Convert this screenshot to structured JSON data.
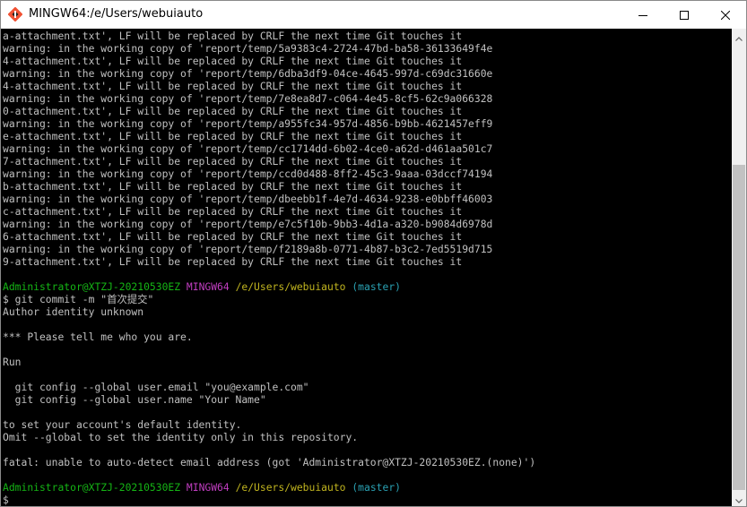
{
  "window": {
    "title": "MINGW64:/e/Users/webuiauto"
  },
  "terminal": {
    "lines": [
      {
        "segments": [
          {
            "text": "a-attachment.txt', LF will be replaced by CRLF the next time Git touches it",
            "color": "white"
          }
        ]
      },
      {
        "segments": [
          {
            "text": "warning: in the working copy of 'report/temp/5a9383c4-2724-47bd-ba58-36133649f4e",
            "color": "white"
          }
        ]
      },
      {
        "segments": [
          {
            "text": "4-attachment.txt', LF will be replaced by CRLF the next time Git touches it",
            "color": "white"
          }
        ]
      },
      {
        "segments": [
          {
            "text": "warning: in the working copy of 'report/temp/6dba3df9-04ce-4645-997d-c69dc31660e",
            "color": "white"
          }
        ]
      },
      {
        "segments": [
          {
            "text": "4-attachment.txt', LF will be replaced by CRLF the next time Git touches it",
            "color": "white"
          }
        ]
      },
      {
        "segments": [
          {
            "text": "warning: in the working copy of 'report/temp/7e8ea8d7-c064-4e45-8cf5-62c9a066328",
            "color": "white"
          }
        ]
      },
      {
        "segments": [
          {
            "text": "0-attachment.txt', LF will be replaced by CRLF the next time Git touches it",
            "color": "white"
          }
        ]
      },
      {
        "segments": [
          {
            "text": "warning: in the working copy of 'report/temp/a955fc34-957d-4856-b9bb-4621457eff9",
            "color": "white"
          }
        ]
      },
      {
        "segments": [
          {
            "text": "e-attachment.txt', LF will be replaced by CRLF the next time Git touches it",
            "color": "white"
          }
        ]
      },
      {
        "segments": [
          {
            "text": "warning: in the working copy of 'report/temp/cc1714dd-6b02-4ce0-a62d-d461aa501c7",
            "color": "white"
          }
        ]
      },
      {
        "segments": [
          {
            "text": "7-attachment.txt', LF will be replaced by CRLF the next time Git touches it",
            "color": "white"
          }
        ]
      },
      {
        "segments": [
          {
            "text": "warning: in the working copy of 'report/temp/ccd0d488-8ff2-45c3-9aaa-03dccf74194",
            "color": "white"
          }
        ]
      },
      {
        "segments": [
          {
            "text": "b-attachment.txt', LF will be replaced by CRLF the next time Git touches it",
            "color": "white"
          }
        ]
      },
      {
        "segments": [
          {
            "text": "warning: in the working copy of 'report/temp/dbeebb1f-4e7d-4634-9238-e0bbff46003",
            "color": "white"
          }
        ]
      },
      {
        "segments": [
          {
            "text": "c-attachment.txt', LF will be replaced by CRLF the next time Git touches it",
            "color": "white"
          }
        ]
      },
      {
        "segments": [
          {
            "text": "warning: in the working copy of 'report/temp/e7c5f10b-9bb3-4d1a-a320-b9084d6978d",
            "color": "white"
          }
        ]
      },
      {
        "segments": [
          {
            "text": "6-attachment.txt', LF will be replaced by CRLF the next time Git touches it",
            "color": "white"
          }
        ]
      },
      {
        "segments": [
          {
            "text": "warning: in the working copy of 'report/temp/f2189a8b-0771-4b87-b3c2-7ed5519d715",
            "color": "white"
          }
        ]
      },
      {
        "segments": [
          {
            "text": "9-attachment.txt', LF will be replaced by CRLF the next time Git touches it",
            "color": "white"
          }
        ]
      },
      {
        "segments": []
      },
      {
        "segments": [
          {
            "text": "Administrator@XTZJ-20210530EZ",
            "color": "green"
          },
          {
            "text": " ",
            "color": "white"
          },
          {
            "text": "MINGW64",
            "color": "magenta"
          },
          {
            "text": " ",
            "color": "white"
          },
          {
            "text": "/e/Users/webuiauto",
            "color": "yellow"
          },
          {
            "text": " ",
            "color": "white"
          },
          {
            "text": "(master)",
            "color": "cyan"
          }
        ]
      },
      {
        "segments": [
          {
            "text": "$ git commit -m \"首次提交\"",
            "color": "white"
          }
        ]
      },
      {
        "segments": [
          {
            "text": "Author identity unknown",
            "color": "white"
          }
        ]
      },
      {
        "segments": []
      },
      {
        "segments": [
          {
            "text": "*** Please tell me who you are.",
            "color": "white"
          }
        ]
      },
      {
        "segments": []
      },
      {
        "segments": [
          {
            "text": "Run",
            "color": "white"
          }
        ]
      },
      {
        "segments": []
      },
      {
        "segments": [
          {
            "text": "  git config --global user.email \"you@example.com\"",
            "color": "white"
          }
        ]
      },
      {
        "segments": [
          {
            "text": "  git config --global user.name \"Your Name\"",
            "color": "white"
          }
        ]
      },
      {
        "segments": []
      },
      {
        "segments": [
          {
            "text": "to set your account's default identity.",
            "color": "white"
          }
        ]
      },
      {
        "segments": [
          {
            "text": "Omit --global to set the identity only in this repository.",
            "color": "white"
          }
        ]
      },
      {
        "segments": []
      },
      {
        "segments": [
          {
            "text": "fatal: unable to auto-detect email address (got 'Administrator@XTZJ-20210530EZ.(none)')",
            "color": "white"
          }
        ]
      },
      {
        "segments": []
      },
      {
        "segments": [
          {
            "text": "Administrator@XTZJ-20210530EZ",
            "color": "green"
          },
          {
            "text": " ",
            "color": "white"
          },
          {
            "text": "MINGW64",
            "color": "magenta"
          },
          {
            "text": " ",
            "color": "white"
          },
          {
            "text": "/e/Users/webuiauto",
            "color": "yellow"
          },
          {
            "text": " ",
            "color": "white"
          },
          {
            "text": "(master)",
            "color": "cyan"
          }
        ]
      },
      {
        "segments": [
          {
            "text": "$",
            "color": "white"
          }
        ]
      }
    ]
  },
  "colors": {
    "background": "#000000",
    "text": "#c0c0c0",
    "green": "#15b515",
    "magenta": "#c13ec1",
    "yellow": "#c0b41f",
    "cyan": "#2aa1b3"
  },
  "icons": {
    "app": "git-bash-icon",
    "minimize": "minimize-icon",
    "maximize": "maximize-icon",
    "close": "close-icon",
    "scroll_up": "scroll-up-arrow-icon",
    "scroll_down": "scroll-down-arrow-icon"
  }
}
